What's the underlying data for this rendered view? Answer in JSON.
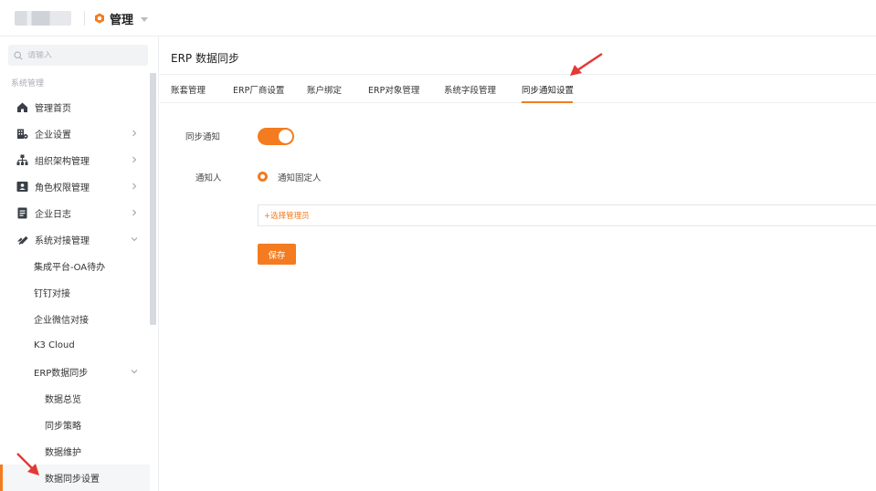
{
  "header": {
    "app_title": "管理",
    "app_icon": "orange-hexagon-icon"
  },
  "sidebar": {
    "search_placeholder": "请输入",
    "section_label": "系统管理",
    "items": [
      {
        "label": "管理首页",
        "icon": "home-icon",
        "level": 1
      },
      {
        "label": "企业设置",
        "icon": "building-icon",
        "level": 1,
        "chevron": "right"
      },
      {
        "label": "组织架构管理",
        "icon": "org-chart-icon",
        "level": 1,
        "chevron": "right"
      },
      {
        "label": "角色权限管理",
        "icon": "id-card-icon",
        "level": 1,
        "chevron": "right"
      },
      {
        "label": "企业日志",
        "icon": "log-icon",
        "level": 1,
        "chevron": "right"
      },
      {
        "label": "系统对接管理",
        "icon": "link-icon",
        "level": 1,
        "chevron": "down"
      },
      {
        "label": "集成平台-OA待办",
        "level": 2
      },
      {
        "label": "钉钉对接",
        "level": 2
      },
      {
        "label": "企业微信对接",
        "level": 2
      },
      {
        "label": "K3 Cloud",
        "level": 2
      },
      {
        "label": "ERP数据同步",
        "level": 2,
        "chevron": "down"
      },
      {
        "label": "数据总览",
        "level": 3
      },
      {
        "label": "同步策略",
        "level": 3
      },
      {
        "label": "数据维护",
        "level": 3
      },
      {
        "label": "数据同步设置",
        "level": 3,
        "active": true
      }
    ]
  },
  "main": {
    "page_title": "ERP 数据同步",
    "tabs": [
      {
        "label": "账套管理"
      },
      {
        "label": "ERP厂商设置"
      },
      {
        "label": "账户绑定"
      },
      {
        "label": "ERP对象管理"
      },
      {
        "label": "系统字段管理"
      },
      {
        "label": "同步通知设置",
        "active": true
      }
    ],
    "form": {
      "sync_notify_label": "同步通知",
      "sync_notify_on": true,
      "notify_person_label": "通知人",
      "notify_option_label": "通知固定人",
      "select_admin_text": "+选择管理员",
      "save_label": "保存"
    }
  },
  "colors": {
    "accent": "#f47b1f",
    "annotation_arrow": "#e53935"
  }
}
